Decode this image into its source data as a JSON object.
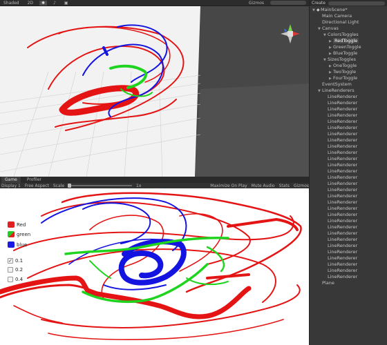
{
  "scene_view": {
    "toolbar": {
      "shading": "Shaded",
      "mode_2d": "2D",
      "gizmos": "Gizmos",
      "icons": [
        "light-icon",
        "audio-icon",
        "effects-icon"
      ]
    }
  },
  "game_view": {
    "tabs": [
      {
        "label": "Game"
      },
      {
        "label": "Profiler"
      }
    ],
    "toolbar": {
      "display": "Display 1",
      "aspect": "Free Aspect",
      "scale_label": "Scale",
      "scale_value": "1x",
      "maximize": "Maximize On Play",
      "mute": "Mute Audio",
      "stats": "Stats",
      "gizmos": "Gizmos"
    },
    "color_toggles": [
      {
        "label": "Red",
        "color": "#e02020"
      },
      {
        "label": "green",
        "color": "#22cc22"
      },
      {
        "label": "blue",
        "color": "#1a1ae0"
      }
    ],
    "size_toggles": [
      {
        "label": "0.1",
        "checked": true
      },
      {
        "label": "0.2",
        "checked": false
      },
      {
        "label": "0.4",
        "checked": false
      }
    ]
  },
  "hierarchy": {
    "create_label": "Create",
    "items": [
      {
        "label": "MainScene*",
        "depth": 0,
        "arrow": "▼",
        "scene": true
      },
      {
        "label": "Main Camera",
        "depth": 1,
        "arrow": ""
      },
      {
        "label": "Directional Light",
        "depth": 1,
        "arrow": ""
      },
      {
        "label": "Canvas",
        "depth": 1,
        "arrow": "▼"
      },
      {
        "label": "ColorsToggles",
        "depth": 2,
        "arrow": "▼"
      },
      {
        "label": "RedToggle",
        "depth": 3,
        "arrow": "▶",
        "selected": true
      },
      {
        "label": "GreenToggle",
        "depth": 3,
        "arrow": "▶"
      },
      {
        "label": "BlueToggle",
        "depth": 3,
        "arrow": "▶"
      },
      {
        "label": "SizesToggles",
        "depth": 2,
        "arrow": "▼"
      },
      {
        "label": "OneToggle",
        "depth": 3,
        "arrow": "▶"
      },
      {
        "label": "TwoToggle",
        "depth": 3,
        "arrow": "▶"
      },
      {
        "label": "FourToggle",
        "depth": 3,
        "arrow": "▶"
      },
      {
        "label": "EventSystem",
        "depth": 1,
        "arrow": ""
      },
      {
        "label": "LineRenderers",
        "depth": 1,
        "arrow": "▼"
      },
      {
        "label": "LineRenderer",
        "depth": 2,
        "arrow": ""
      },
      {
        "label": "LineRenderer",
        "depth": 2,
        "arrow": ""
      },
      {
        "label": "LineRenderer",
        "depth": 2,
        "arrow": ""
      },
      {
        "label": "LineRenderer",
        "depth": 2,
        "arrow": ""
      },
      {
        "label": "LineRenderer",
        "depth": 2,
        "arrow": ""
      },
      {
        "label": "LineRenderer",
        "depth": 2,
        "arrow": ""
      },
      {
        "label": "LineRenderer",
        "depth": 2,
        "arrow": ""
      },
      {
        "label": "LineRenderer",
        "depth": 2,
        "arrow": ""
      },
      {
        "label": "LineRenderer",
        "depth": 2,
        "arrow": ""
      },
      {
        "label": "LineRenderer",
        "depth": 2,
        "arrow": ""
      },
      {
        "label": "LineRenderer",
        "depth": 2,
        "arrow": ""
      },
      {
        "label": "LineRenderer",
        "depth": 2,
        "arrow": ""
      },
      {
        "label": "LineRenderer",
        "depth": 2,
        "arrow": ""
      },
      {
        "label": "LineRenderer",
        "depth": 2,
        "arrow": ""
      },
      {
        "label": "LineRenderer",
        "depth": 2,
        "arrow": ""
      },
      {
        "label": "LineRenderer",
        "depth": 2,
        "arrow": ""
      },
      {
        "label": "LineRenderer",
        "depth": 2,
        "arrow": ""
      },
      {
        "label": "LineRenderer",
        "depth": 2,
        "arrow": ""
      },
      {
        "label": "LineRenderer",
        "depth": 2,
        "arrow": ""
      },
      {
        "label": "LineRenderer",
        "depth": 2,
        "arrow": ""
      },
      {
        "label": "LineRenderer",
        "depth": 2,
        "arrow": ""
      },
      {
        "label": "LineRenderer",
        "depth": 2,
        "arrow": ""
      },
      {
        "label": "LineRenderer",
        "depth": 2,
        "arrow": ""
      },
      {
        "label": "LineRenderer",
        "depth": 2,
        "arrow": ""
      },
      {
        "label": "LineRenderer",
        "depth": 2,
        "arrow": ""
      },
      {
        "label": "LineRenderer",
        "depth": 2,
        "arrow": ""
      },
      {
        "label": "LineRenderer",
        "depth": 2,
        "arrow": ""
      },
      {
        "label": "LineRenderer",
        "depth": 2,
        "arrow": ""
      },
      {
        "label": "LineRenderer",
        "depth": 2,
        "arrow": ""
      },
      {
        "label": "LineRenderer",
        "depth": 2,
        "arrow": ""
      },
      {
        "label": "Plane",
        "depth": 1,
        "arrow": ""
      }
    ]
  },
  "colors": {
    "stroke_red": "#e41414",
    "stroke_green": "#1ed41e",
    "stroke_blue": "#1414e0",
    "editor_bg": "#383838",
    "selection": "#4a4a4a"
  }
}
